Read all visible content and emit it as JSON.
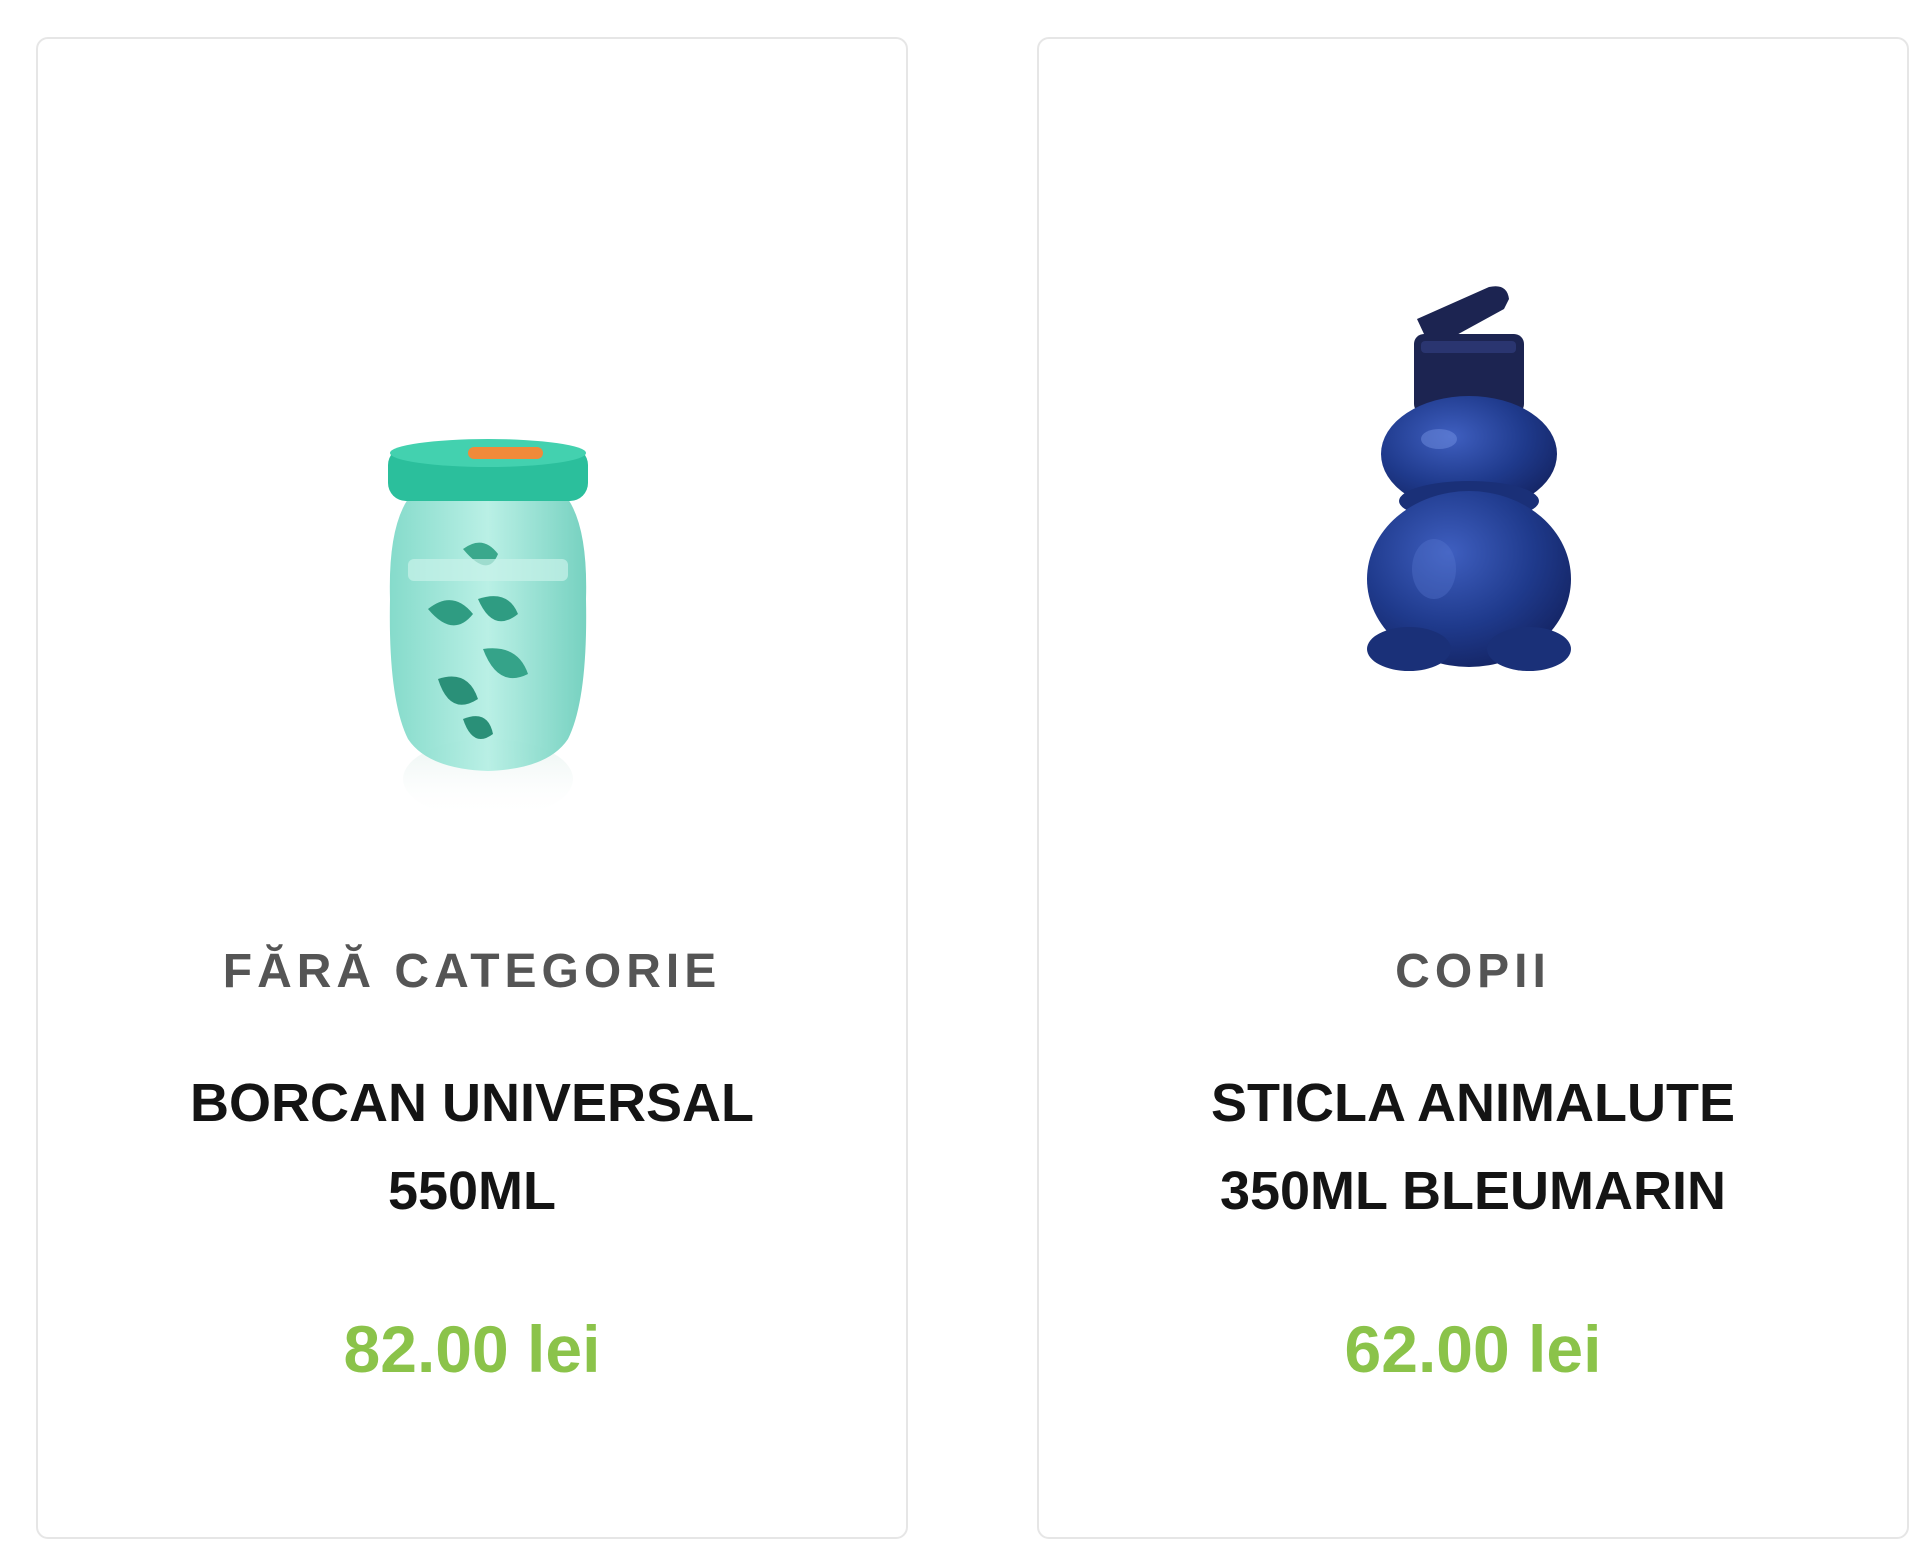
{
  "products": [
    {
      "category": "FĂRĂ CATEGORIE",
      "title": "BORCAN UNIVERSAL 550ML",
      "price": "82.00 lei",
      "image_icon": "jar-product-image",
      "image_colors": {
        "lid": "#2bbf9c",
        "body": "#8fe0d2",
        "leaf": "#2f9c82"
      }
    },
    {
      "category": "COPII",
      "title": "STICLA ANIMALUTE 350ML BLEUMARIN",
      "price": "62.00 lei",
      "image_icon": "bottle-product-image",
      "image_colors": {
        "cap": "#1c2451",
        "body": "#1f3a8c"
      }
    }
  ],
  "colors": {
    "price": "#8bc34a",
    "category": "#555555",
    "title": "#141414",
    "card_border": "#e6e6e6"
  }
}
